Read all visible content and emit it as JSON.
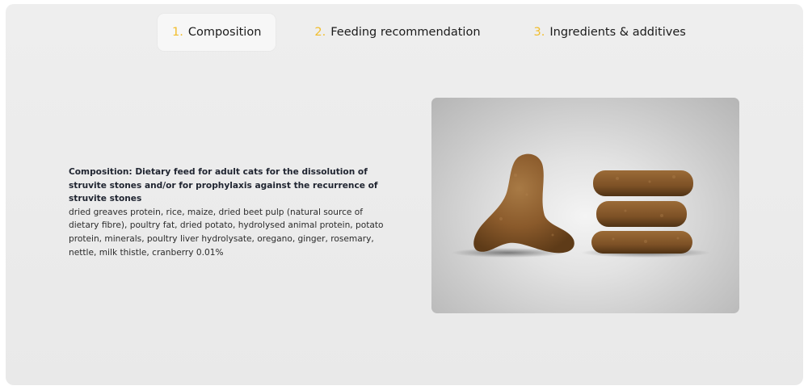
{
  "tabs": [
    {
      "number": "1.",
      "label": "Composition",
      "active": true
    },
    {
      "number": "2.",
      "label": "Feeding recommendation",
      "active": false
    },
    {
      "number": "3.",
      "label": "Ingredients & additives",
      "active": false
    }
  ],
  "composition": {
    "title": "Composition: Dietary feed for adult cats for the dissolution of struvite stones and/or for prophylaxis against the recurrence of struvite stones",
    "body": "dried greaves protein, rice, maize, dried beet pulp (natural source of dietary fibre), poultry fat, dried potato, hydrolysed animal protein, potato protein, minerals, poultry liver hydrolysate, oregano, ginger, rosemary, nettle, milk thistle, cranberry 0.01%"
  },
  "image": {
    "icon": "kibble-photo",
    "kibble_color": "#8a5a2b",
    "kibble_dark": "#5e3b18",
    "kibble_light": "#a87a45"
  },
  "colors": {
    "accent": "#f2bd2b",
    "active_tab_bg": "#f7f7f7",
    "panel_bg": "#ececec"
  }
}
